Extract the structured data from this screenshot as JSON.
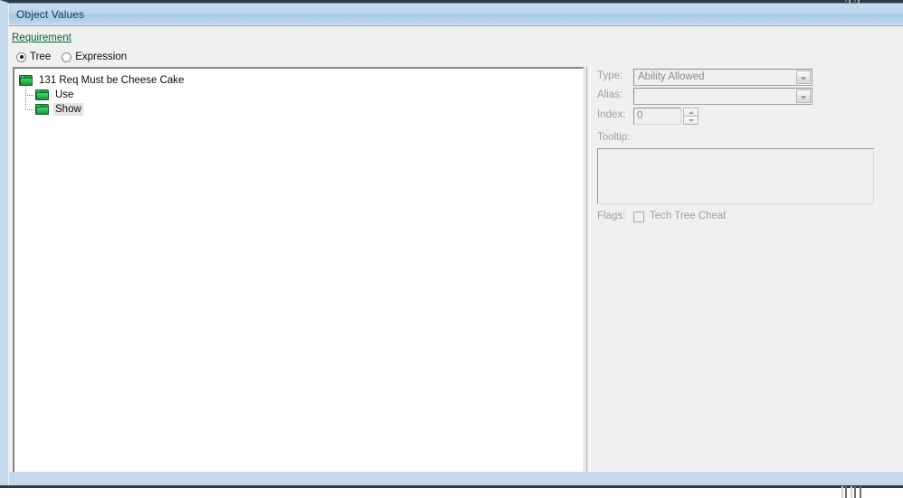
{
  "window": {
    "title": "Object Values",
    "accent_color": "#c5d9ed",
    "frame_color": "#2b3c4a"
  },
  "header": {
    "requirement_link": "Requirement",
    "link_color": "#006633"
  },
  "view_modes": [
    {
      "label": "Tree",
      "selected": true
    },
    {
      "label": "Expression",
      "selected": false
    }
  ],
  "tree": {
    "nodes": [
      {
        "label": "131 Req Must be Cheese Cake",
        "icon": "folder-icon",
        "level": 0,
        "selected": false
      },
      {
        "label": "Use",
        "icon": "folder-icon",
        "level": 1,
        "selected": false
      },
      {
        "label": "Show",
        "icon": "folder-icon",
        "level": 1,
        "selected": true
      }
    ],
    "folder_color": "#22a145"
  },
  "properties": {
    "type": {
      "label": "Type:",
      "value": "Ability Allowed",
      "enabled": false
    },
    "alias": {
      "label": "Alias:",
      "value": "",
      "enabled": false
    },
    "index": {
      "label": "Index:",
      "value": "0",
      "enabled": false
    },
    "tooltip": {
      "label": "Tooltip:",
      "value": "",
      "enabled": false
    },
    "flags": {
      "label": "Flags:",
      "items": [
        {
          "label": "Tech Tree Cheat",
          "checked": false
        }
      ]
    }
  },
  "statusbar": {
    "text": ""
  }
}
